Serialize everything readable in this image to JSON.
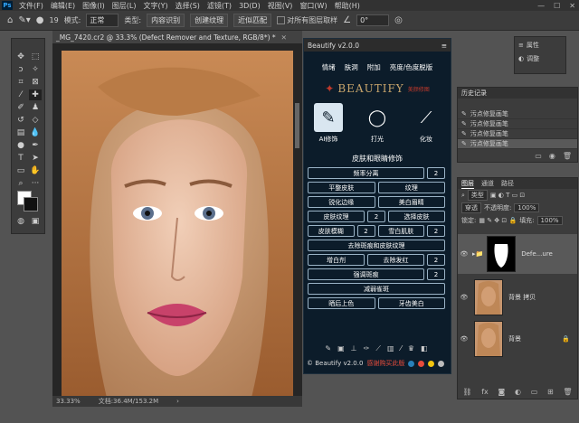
{
  "menubar": {
    "logo": "Ps",
    "items": [
      "文件(F)",
      "编辑(E)",
      "图像(I)",
      "图层(L)",
      "文字(Y)",
      "选择(S)",
      "滤镜(T)",
      "3D(D)",
      "视图(V)",
      "窗口(W)",
      "帮助(H)"
    ],
    "window_controls": [
      "—",
      "☐",
      "✕"
    ]
  },
  "options": {
    "brush_size": "19",
    "mode_label": "模式:",
    "mode_value": "正常",
    "type_label": "类型:",
    "content_aware": "内容识别",
    "create_texture": "创建纹理",
    "proximity": "近似匹配",
    "sample_all": "对所有图层取样",
    "angle": "0°"
  },
  "document": {
    "tab_title": "_MG_7420.cr2 @ 33.3% (Defect Remover and Texture, RGB/8*) *",
    "zoom": "33.33%",
    "doc_size": "文档:36.4M/153.2M"
  },
  "plugin": {
    "title": "Beautify v2.0.0",
    "nav": [
      "情绪",
      "肤洞",
      "附加",
      "亮度/色度脱版"
    ],
    "brand": "BEAUTIFY",
    "brand_sub": "美颜修图",
    "modes": [
      {
        "label": "AI修饰",
        "icon": "brush-icon"
      },
      {
        "label": "打光",
        "icon": "compact-icon"
      },
      {
        "label": "化妆",
        "icon": "makeup-brush-icon"
      }
    ],
    "section_title": "皮肤和眼睛修饰",
    "buttons": {
      "freq_sep": "频率分离",
      "freq_sep_num": "2",
      "smooth_skin": "平整皮肤",
      "texture": "纹理",
      "sharpen_edges": "锐化边缘",
      "beautify_brows": "美白眉睛",
      "skin_texture": "皮肤纹理",
      "skin_texture_num": "2",
      "select_skin": "选择皮肤",
      "skin_blur": "皮肤模糊",
      "skin_blur_num": "2",
      "snow_white": "雪白肌肤",
      "snow_white_num": "2",
      "remove_spots": "去除斑痕和皮肤纹理",
      "add_shadow": "增白剂",
      "remove_red": "去除发红",
      "remove_red_num": "2",
      "strong_spots": "强调斑痕",
      "strong_spots_num": "2",
      "reduce_shine": "减弱雀斑",
      "tan": "晒后上色",
      "teeth": "牙齿美白"
    },
    "footer_text": "© Beautify v2.0.0",
    "footer_red": "感谢购买此版"
  },
  "minipanel": {
    "properties": "属性",
    "adjustments": "调整"
  },
  "history": {
    "tab": "历史记录",
    "items": [
      "污点修复画笔",
      "污点修复画笔",
      "污点修复画笔",
      "污点修复画笔"
    ]
  },
  "layers": {
    "tabs": [
      "图层",
      "通道",
      "路径"
    ],
    "kind": "类型",
    "blend": "穿透",
    "opacity_label": "不透明度:",
    "opacity": "100%",
    "lock_label": "锁定:",
    "fill_label": "填充:",
    "fill": "100%",
    "items": [
      {
        "name": "Defe...ure"
      },
      {
        "name": "背景 拷贝"
      },
      {
        "name": "背景"
      }
    ]
  }
}
